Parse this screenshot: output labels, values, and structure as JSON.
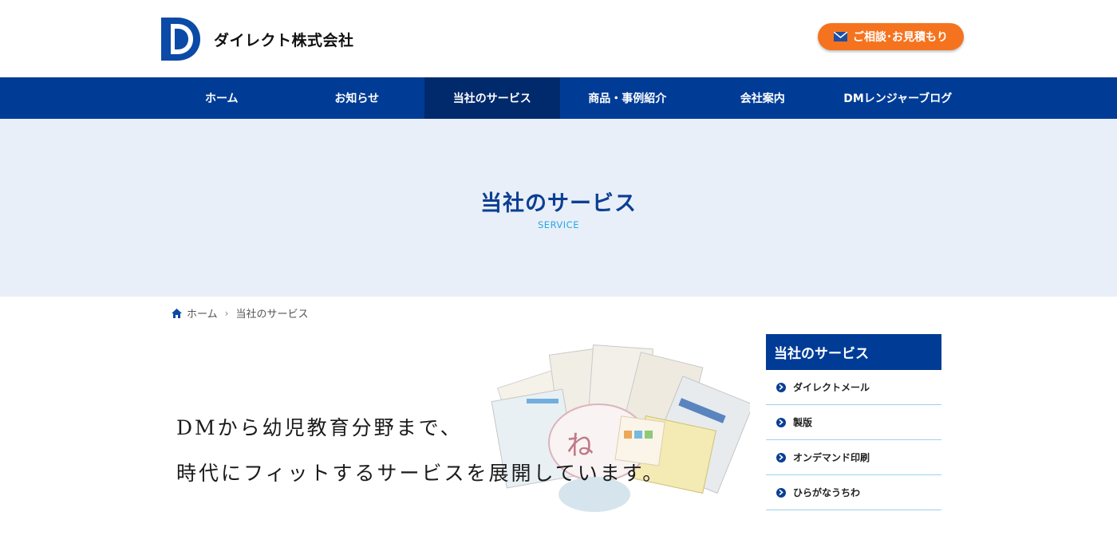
{
  "header": {
    "company_name": "ダイレクト株式会社",
    "contact_label": "ご相談･お見積もり",
    "accent_color": "#f5731e"
  },
  "nav": {
    "items": [
      {
        "label": "ホーム"
      },
      {
        "label": "お知らせ"
      },
      {
        "label": "当社のサービス"
      },
      {
        "label": "商品・事例紹介"
      },
      {
        "label": "会社案内"
      },
      {
        "label": "DMレンジャーブログ"
      }
    ],
    "active_index": 2,
    "color": "#003c96"
  },
  "hero": {
    "title": "当社のサービス",
    "subtitle": "SERVICE"
  },
  "breadcrumb": {
    "home": "ホーム",
    "separator": "›",
    "current": "当社のサービス"
  },
  "main": {
    "copy_line1": "DMから幼児教育分野まで、",
    "copy_line2": "時代にフィットするサービスを展開しています。"
  },
  "sidebar": {
    "title": "当社のサービス",
    "items": [
      {
        "label": "ダイレクトメール"
      },
      {
        "label": "製版"
      },
      {
        "label": "オンデマンド印刷"
      },
      {
        "label": "ひらがなうちわ"
      }
    ]
  }
}
